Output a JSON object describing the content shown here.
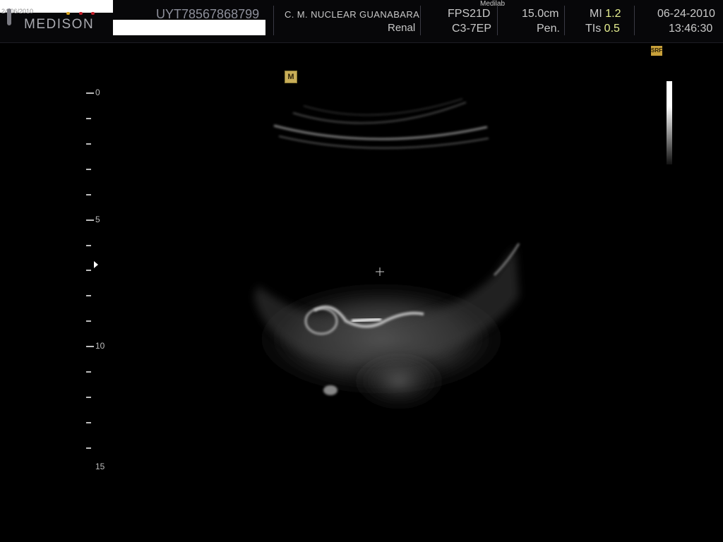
{
  "header": {
    "small_overlay_date": "24/06/2010",
    "brand": "MEDISON",
    "patient_id": "UYT78567868799",
    "institution": "C. M. NUCLEAR  GUANABARA",
    "application": "Renal",
    "frame_rate": "FPS21D",
    "probe": "C3-7EP",
    "depth": "15.0cm",
    "preset": "Pen.",
    "mi_label": "MI",
    "mi_value": "1.2",
    "tis_label": "TIs",
    "tis_value": "0.5",
    "date": "06-24-2010",
    "time": "13:46:30",
    "medilab_label": "Medilab"
  },
  "image": {
    "m_badge": "M",
    "srf_badge": "SRF",
    "depth_labels": [
      "0",
      "5",
      "10",
      "15"
    ]
  },
  "colors": {
    "background": "#000000",
    "header_bg": "#070709",
    "value_highlight": "#e6ef90",
    "badge_yellow": "#c9ae58",
    "logo_red": "#c21f2a",
    "logo_yellow": "#d9a319"
  }
}
